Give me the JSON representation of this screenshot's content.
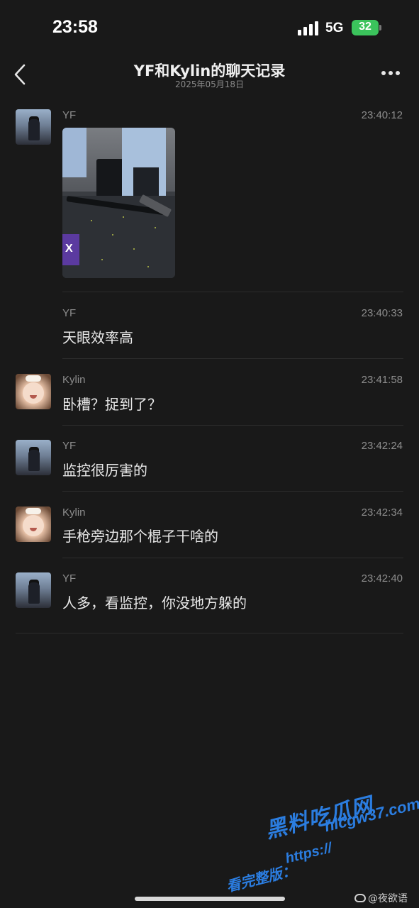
{
  "status_bar": {
    "time": "23:58",
    "network": "5G",
    "battery": "32",
    "battery_color": "#3bc35c"
  },
  "nav": {
    "back_icon": "chevron-left-icon",
    "title": "YF和Kylin的聊天记录",
    "subtitle": "2025年05月18日",
    "more_icon": "more-horizontal-icon"
  },
  "messages": [
    {
      "sender": "YF",
      "time": "23:40:12",
      "type": "image",
      "image_desc": "photo"
    },
    {
      "sender": "YF",
      "time": "23:40:33",
      "type": "text",
      "text": "天眼效率高"
    },
    {
      "sender": "Kylin",
      "time": "23:41:58",
      "type": "text",
      "text": "卧槽？捉到了？"
    },
    {
      "sender": "YF",
      "time": "23:42:24",
      "type": "text",
      "text": "监控很厉害的"
    },
    {
      "sender": "Kylin",
      "time": "23:42:34",
      "type": "text",
      "text": "手枪旁边那个棍子干啥的"
    },
    {
      "sender": "YF",
      "time": "23:42:40",
      "type": "text",
      "text": "人多，看监控，你没地方躲的"
    }
  ],
  "photo": {
    "sign_text": "X"
  },
  "watermark": {
    "brand": "黑料吃瓜网",
    "url": "hlcgw37.com",
    "prefix": "看完整版：",
    "https": "https://"
  },
  "footer": {
    "weibo_credit": "@夜欲语"
  }
}
